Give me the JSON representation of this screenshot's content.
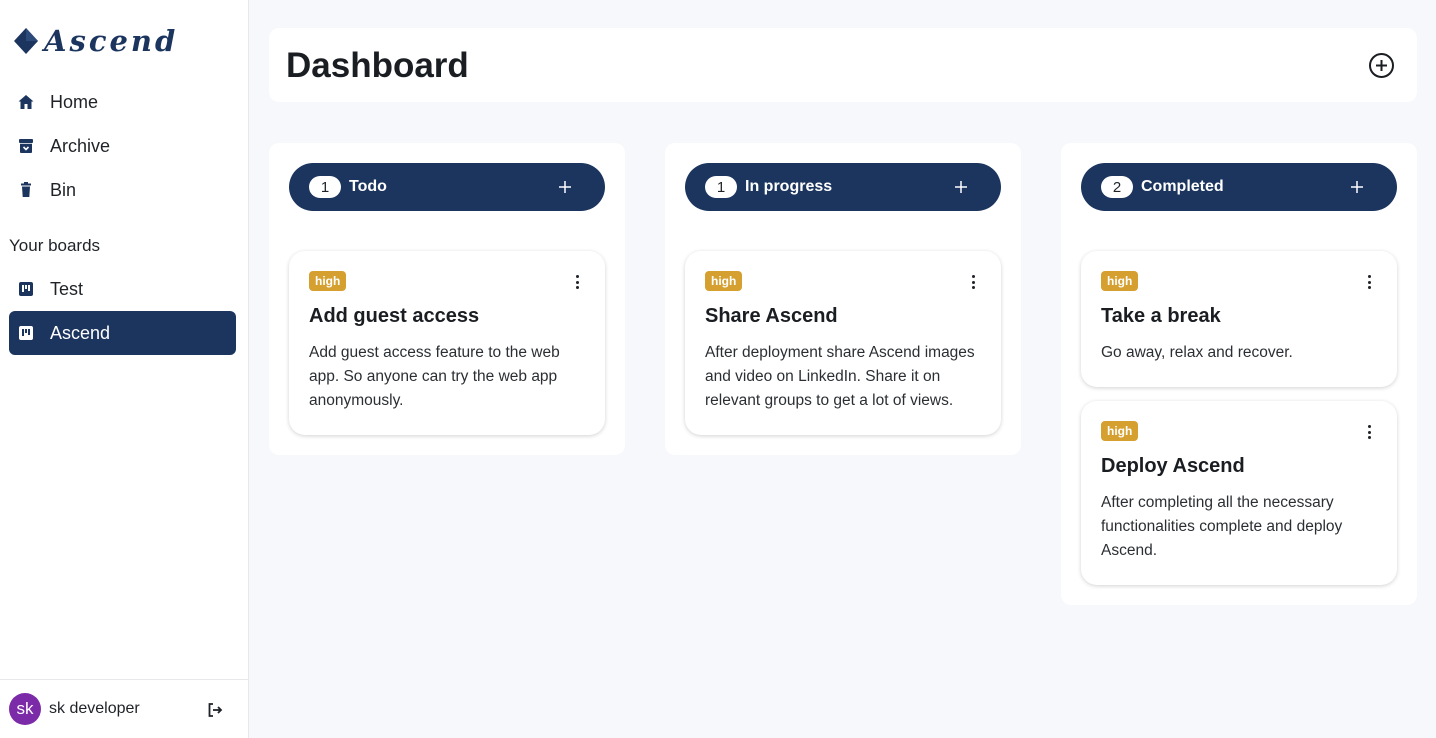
{
  "app": {
    "logo_text": "Ascend",
    "brand_color": "#1c355e"
  },
  "nav": {
    "items": [
      {
        "label": "Home",
        "icon": "home-icon"
      },
      {
        "label": "Archive",
        "icon": "archive-icon"
      },
      {
        "label": "Bin",
        "icon": "trash-icon"
      }
    ],
    "boards_title": "Your boards",
    "boards": [
      {
        "label": "Test",
        "icon": "board-icon",
        "active": false
      },
      {
        "label": "Ascend",
        "icon": "board-icon",
        "active": true
      }
    ]
  },
  "user": {
    "initials": "sk",
    "name": "sk developer"
  },
  "header": {
    "title": "Dashboard"
  },
  "columns": [
    {
      "title": "Todo",
      "count": "1",
      "cards": [
        {
          "priority": "high",
          "title": "Add guest access",
          "description": "Add guest access feature to the web app. So anyone can try the web app anonymously."
        }
      ]
    },
    {
      "title": "In progress",
      "count": "1",
      "cards": [
        {
          "priority": "high",
          "title": "Share Ascend",
          "description": "After deployment share Ascend images and video on LinkedIn. Share it on relevant groups to get a lot of views."
        }
      ]
    },
    {
      "title": "Completed",
      "count": "2",
      "cards": [
        {
          "priority": "high",
          "title": "Take a break",
          "description": "Go away, relax and recover."
        },
        {
          "priority": "high",
          "title": "Deploy Ascend",
          "description": "After completing all the necessary functionalities complete and deploy Ascend."
        }
      ]
    }
  ],
  "colors": {
    "priority_high": "#d6a030",
    "avatar": "#7b2aa8"
  }
}
